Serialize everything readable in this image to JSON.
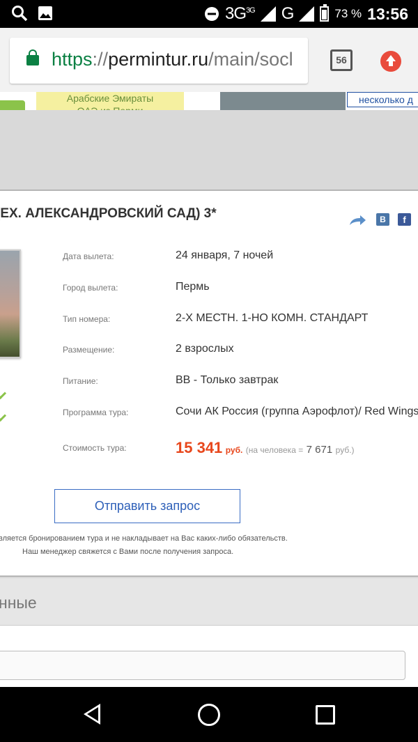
{
  "status_bar": {
    "network_label": "3G",
    "network_sup": "3G",
    "network_2": "G",
    "battery_pct": "73 %",
    "time": "13:56"
  },
  "browser": {
    "url_scheme": "https",
    "url_sep": "://",
    "url_host": "permintur.ru",
    "url_path": "/main/socl",
    "tabs_count": "56"
  },
  "background_page": {
    "banner_text": "Арабские Эмираты",
    "banner_text_2": "ОАЭ из Перми",
    "notice_text": "несколько д"
  },
  "modal": {
    "hotel_title": "(ЕХ. АЛЕКСАНДРОВСКИЙ САД) 3*",
    "share_vk": "В",
    "share_fb": "f",
    "rows": [
      {
        "label": "Дата вылета:",
        "value": "24 января, 7 ночей"
      },
      {
        "label": "Город вылета:",
        "value": "Пермь"
      },
      {
        "label": "Тип номера:",
        "value": "2-Х МЕСТН. 1-НО КОМН. СТАНДАРТ"
      },
      {
        "label": "Размещение:",
        "value": "2 взрослых"
      },
      {
        "label": "Питание:",
        "value": "BB - Только завтрак"
      },
      {
        "label": "Программа тура:",
        "value": "Сочи АК Россия (группа Аэрофлот)/ Red Wings"
      }
    ],
    "price": {
      "label": "Стоимость тура:",
      "amount": "15 341",
      "currency": "руб.",
      "per_person_prefix": "(на человека =",
      "per_person_amount": "7 671",
      "per_person_suffix": "руб.)"
    },
    "send_button": "Отправить запрос",
    "disclaimer_1": "вляется бронированием тура и не накладывает на Вас каких-либо обязательств.",
    "disclaimer_2": "Наш менеджер свяжется с Вами после получения запроса."
  },
  "page": {
    "section_heading": "нные"
  }
}
